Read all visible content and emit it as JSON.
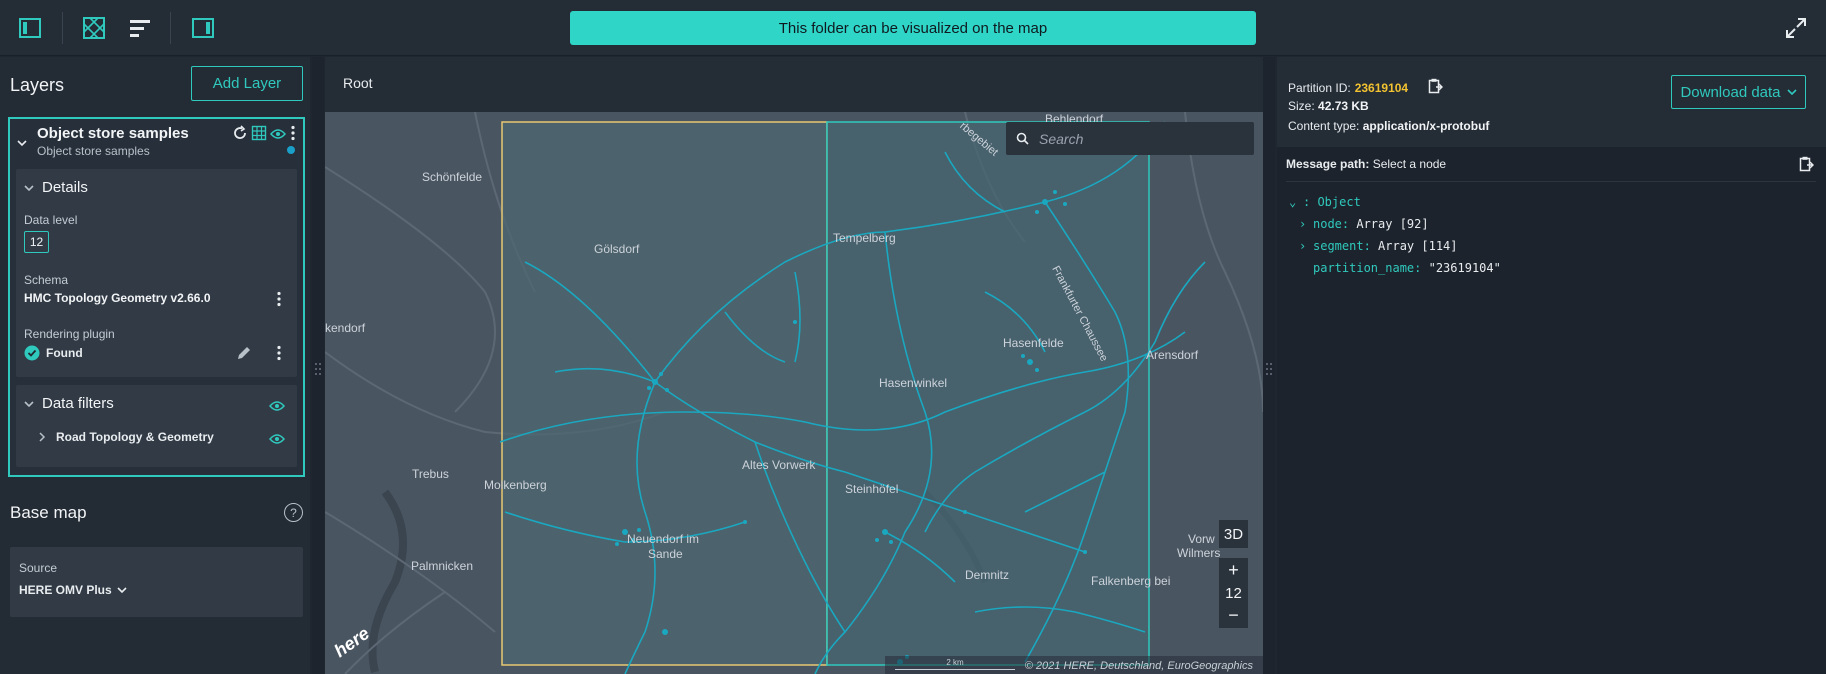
{
  "topbar": {
    "banner": "This folder can be visualized on the map",
    "icons": [
      "sidebar-left-icon",
      "map-grid-icon",
      "list-icon",
      "sidebar-right-icon",
      "fullscreen-icon"
    ]
  },
  "layers": {
    "title": "Layers",
    "add_button": "Add Layer",
    "layer": {
      "title": "Object store samples",
      "subtitle": "Object store samples",
      "details": {
        "heading": "Details",
        "data_level_label": "Data level",
        "data_level": "12",
        "schema_label": "Schema",
        "schema_value": "HMC Topology Geometry v2.66.0",
        "plugin_label": "Rendering plugin",
        "plugin_value": "Found"
      },
      "filters": {
        "heading": "Data filters",
        "item": "Road Topology & Geometry"
      }
    },
    "basemap": {
      "title": "Base map",
      "help": "?",
      "source_label": "Source",
      "source_value": "HERE OMV Plus"
    }
  },
  "map": {
    "breadcrumb": "Root",
    "search_placeholder": "Search",
    "btn_3d": "3D",
    "zoom_in": "+",
    "zoom_level": "12",
    "zoom_out": "−",
    "scale": "2 km",
    "copyright": "© 2021 HERE, Deutschland, EuroGeographics",
    "logo": "here",
    "places": [
      {
        "name": "Schönfelde"
      },
      {
        "name": "Gölsdorf"
      },
      {
        "name": "Tempelberg"
      },
      {
        "name": "Behlendorf"
      },
      {
        "name": "Frankfurter Chaussee"
      },
      {
        "name": "Hasenfelde"
      },
      {
        "name": "Arensdorf"
      },
      {
        "name": "Hasenwinkel"
      },
      {
        "name": "kendorf"
      },
      {
        "name": "Trebus"
      },
      {
        "name": "Molkenberg"
      },
      {
        "name": "Altes Vorwerk"
      },
      {
        "name": "Steinhöfel"
      },
      {
        "name": "Neuendorf im"
      },
      {
        "name": "Sande"
      },
      {
        "name": "Palmnicken"
      },
      {
        "name": "Demnitz"
      },
      {
        "name": "Vorw"
      },
      {
        "name": "Wilmers"
      },
      {
        "name": "Falkenberg bei"
      },
      {
        "name": "rbegebiet"
      }
    ]
  },
  "inspector": {
    "partition_label": "Partition ID:",
    "partition_id": "23619104",
    "size_label": "Size:",
    "size_value": "42.73 KB",
    "content_label": "Content type:",
    "content_value": "application/x-protobuf",
    "download": "Download data",
    "message_path_label": "Message path:",
    "message_path_value": "Select a node",
    "tree": {
      "root": ": Object",
      "node_key": "node:",
      "node_val": "Array [92]",
      "segment_key": "segment:",
      "segment_val": "Array [114]",
      "partition_key": "partition_name:",
      "partition_val": "\"23619104\""
    }
  },
  "colors": {
    "accent": "#2fc9bd",
    "partition_yellow": "#f2c230",
    "map_bg": "#4a5662",
    "roads": "#1aa8c0"
  }
}
